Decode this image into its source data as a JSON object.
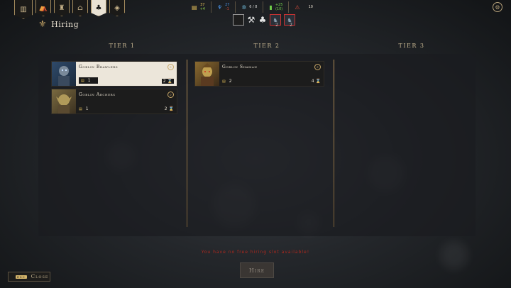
{
  "header": {
    "title": "Hiring",
    "tabs": [
      {
        "icon": "book-icon",
        "glyph": "▥",
        "active": false
      },
      {
        "icon": "camp-icon",
        "glyph": "⛺",
        "active": false
      },
      {
        "icon": "tower-icon",
        "glyph": "♜",
        "active": false
      },
      {
        "icon": "house-icon",
        "glyph": "⌂",
        "active": false
      },
      {
        "icon": "hiring-icon",
        "glyph": "♣",
        "active": true
      },
      {
        "icon": "bestiary-icon",
        "glyph": "◈",
        "active": false
      }
    ]
  },
  "resources": [
    {
      "icon": "gold-icon",
      "top": "37",
      "bottom": "+4"
    },
    {
      "icon": "mana-icon",
      "top": "27",
      "bottom": "-1"
    },
    {
      "icon": "gear-icon",
      "top": "6 / 8",
      "bottom": ""
    },
    {
      "icon": "food-icon",
      "top": "+25",
      "bottom": "(10)"
    },
    {
      "icon": "threat-icon",
      "top": "10",
      "bottom": ""
    }
  ],
  "filters": {
    "unit_slot_1_count": "2",
    "unit_slot_2_count": "2"
  },
  "tiers": [
    {
      "label": "Tier 1",
      "units": [
        {
          "name": "Goblin Brawlers",
          "cost": "1",
          "time": "2",
          "selected": true
        },
        {
          "name": "Goblin Archers",
          "cost": "1",
          "time": "2",
          "selected": false
        }
      ]
    },
    {
      "label": "Tier 2",
      "units": [
        {
          "name": "Goblin Shaman",
          "cost": "2",
          "time": "4",
          "selected": false
        }
      ]
    },
    {
      "label": "Tier 3",
      "units": []
    }
  ],
  "warning": "You have no free hiring slot available!",
  "buttons": {
    "hire": "Hire",
    "close": "Close",
    "close_key": "ESC"
  },
  "colors": {
    "accent_gold": "#c9a869",
    "warning_red": "#b0281e"
  }
}
